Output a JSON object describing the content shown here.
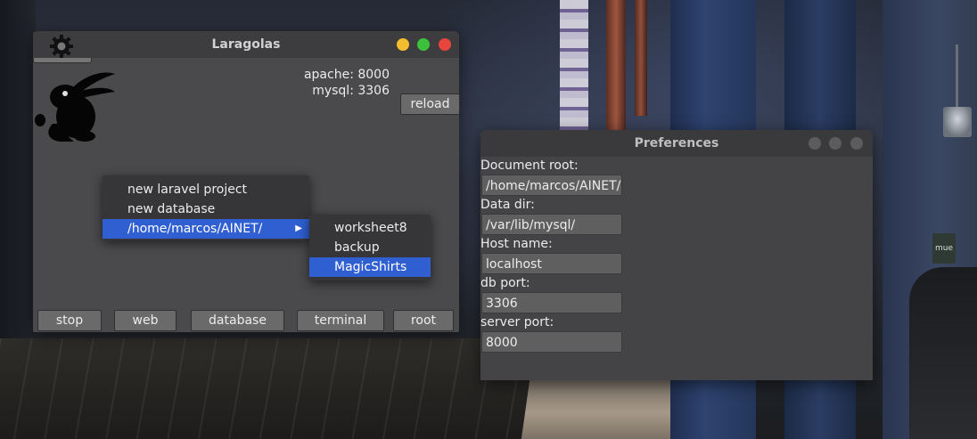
{
  "laragolas": {
    "title": "Laragolas",
    "status": {
      "apache": "apache: 8000",
      "mysql": "mysql: 3306"
    },
    "reload_label": "reload",
    "bottom_buttons": [
      "stop",
      "web",
      "database",
      "terminal",
      "root"
    ],
    "window_controls": {
      "minimize_color": "#f4bd2e",
      "maximize_color": "#3dc13c",
      "close_color": "#e8453c"
    }
  },
  "context_menu": {
    "items": [
      "new laravel project",
      "new database",
      "/home/marcos/AINET/"
    ],
    "selected_index": 2,
    "submenu": {
      "items": [
        "worksheet8",
        "backup",
        "MagicShirts"
      ],
      "selected_index": 2
    }
  },
  "preferences": {
    "title": "Preferences",
    "fields": [
      {
        "label": "Document root:",
        "value": "/home/marcos/AINET/"
      },
      {
        "label": "Data dir:",
        "value": "/var/lib/mysql/"
      },
      {
        "label": "Host name:",
        "value": "localhost"
      },
      {
        "label": "db port:",
        "value": "3306"
      },
      {
        "label": "server port:",
        "value": "8000"
      }
    ]
  },
  "desktop": {
    "sign_text": "mue"
  },
  "colors": {
    "highlight": "#2f5fd0",
    "window_bg": "#4a4a4c",
    "button_bg": "#6a6a6b"
  }
}
